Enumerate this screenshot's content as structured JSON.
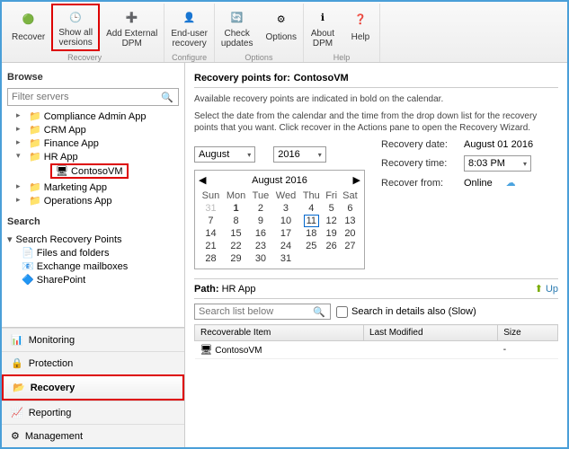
{
  "toolbar": {
    "groups": [
      {
        "label": "Recovery",
        "items": [
          "Recover",
          "Show all\nversions",
          "Add External\nDPM"
        ]
      },
      {
        "label": "Configure",
        "items": [
          "End-user\nrecovery"
        ]
      },
      {
        "label": "Options",
        "items": [
          "Check\nupdates",
          "Options"
        ]
      },
      {
        "label": "Help",
        "items": [
          "About\nDPM",
          "Help"
        ]
      }
    ],
    "highlight_index": 1
  },
  "browse": {
    "title": "Browse",
    "filter_placeholder": "Filter servers",
    "tree": [
      {
        "label": "Compliance Admin App"
      },
      {
        "label": "CRM App"
      },
      {
        "label": "Finance App"
      },
      {
        "label": "HR App",
        "open": true,
        "children": [
          {
            "label": "ContosoVM",
            "selected": true
          }
        ]
      },
      {
        "label": "Marketing App"
      },
      {
        "label": "Operations App"
      }
    ]
  },
  "search": {
    "title": "Search",
    "group": "Search Recovery Points",
    "items": [
      "Files and folders",
      "Exchange mailboxes",
      "SharePoint"
    ]
  },
  "nav": [
    "Monitoring",
    "Protection",
    "Recovery",
    "Reporting",
    "Management"
  ],
  "nav_active": "Recovery",
  "recovery": {
    "heading_prefix": "Recovery points for:",
    "target": "ContosoVM",
    "desc1": "Available recovery points are indicated in bold on the calendar.",
    "desc2": "Select the date from the calendar and the time from the drop down list for the recovery points that you want. Click recover in the Actions pane to open the Recovery Wizard.",
    "month": "August",
    "year": "2016",
    "date_label": "Recovery date:",
    "date_value": "August 01 2016",
    "time_label": "Recovery time:",
    "time_value": "8:03 PM",
    "from_label": "Recover from:",
    "from_value": "Online",
    "calendar": {
      "title": "August 2016",
      "dow": [
        "Sun",
        "Mon",
        "Tue",
        "Wed",
        "Thu",
        "Fri",
        "Sat"
      ],
      "weeks": [
        [
          {
            "n": 31,
            "dim": true
          },
          {
            "n": 1,
            "bold": true
          },
          {
            "n": 2
          },
          {
            "n": 3
          },
          {
            "n": 4
          },
          {
            "n": 5
          },
          {
            "n": 6
          }
        ],
        [
          {
            "n": 7
          },
          {
            "n": 8
          },
          {
            "n": 9
          },
          {
            "n": 10
          },
          {
            "n": 11,
            "today": true
          },
          {
            "n": 12
          },
          {
            "n": 13
          }
        ],
        [
          {
            "n": 14
          },
          {
            "n": 15
          },
          {
            "n": 16
          },
          {
            "n": 17
          },
          {
            "n": 18
          },
          {
            "n": 19
          },
          {
            "n": 20
          }
        ],
        [
          {
            "n": 21
          },
          {
            "n": 22
          },
          {
            "n": 23
          },
          {
            "n": 24
          },
          {
            "n": 25
          },
          {
            "n": 26
          },
          {
            "n": 27
          }
        ],
        [
          {
            "n": 28
          },
          {
            "n": 29
          },
          {
            "n": 30
          },
          {
            "n": 31
          },
          {
            "n": "",
            "dim": true
          },
          {
            "n": "",
            "dim": true
          },
          {
            "n": "",
            "dim": true
          }
        ]
      ]
    },
    "path_label": "Path:",
    "path_value": "HR App",
    "up": "Up",
    "search_placeholder": "Search list below",
    "search_slow": "Search in details also (Slow)",
    "columns": [
      "Recoverable Item",
      "Last Modified",
      "Size"
    ],
    "rows": [
      {
        "item": "ContosoVM",
        "modified": "",
        "size": "-"
      }
    ]
  }
}
